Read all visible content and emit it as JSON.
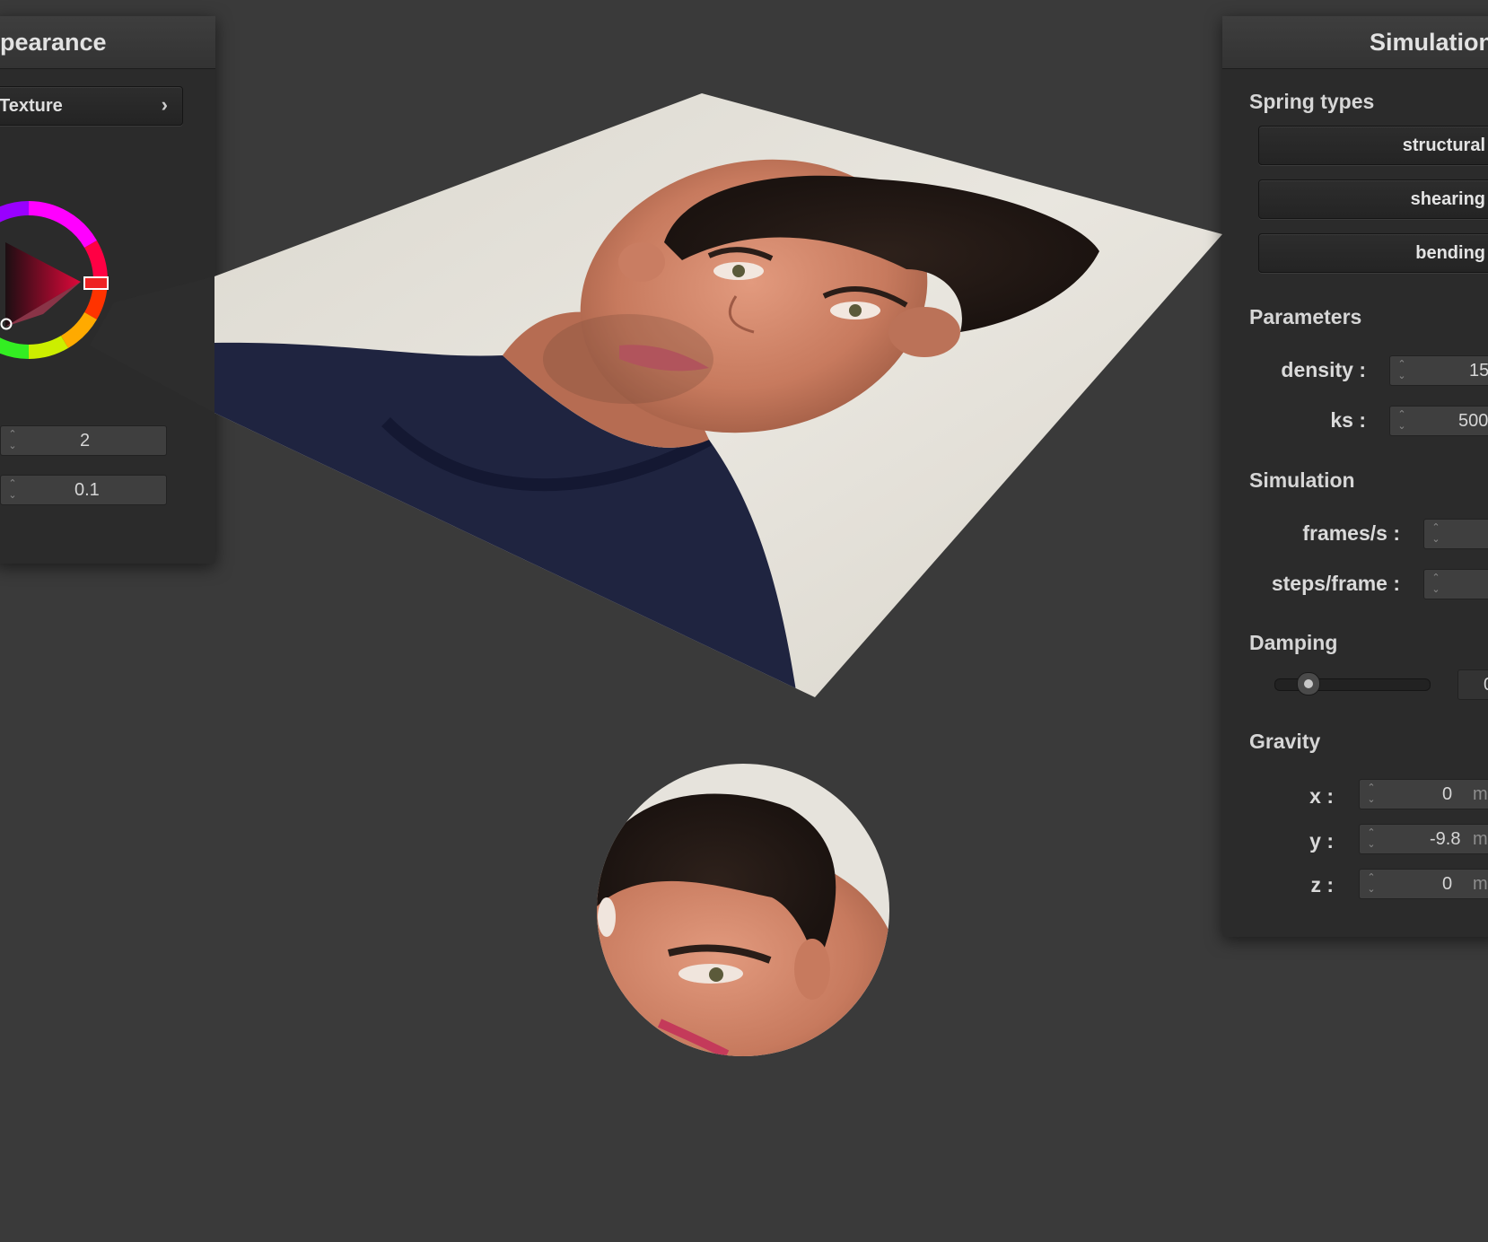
{
  "appearance_panel": {
    "title": "pearance",
    "texture_button": "Texture",
    "texture_chevron": "›",
    "spin1_value": "2",
    "spin2_value": "0.1"
  },
  "simulation_panel": {
    "title": "Simulation",
    "spring_types": {
      "label": "Spring types",
      "structural": "structural",
      "shearing": "shearing",
      "bending": "bending"
    },
    "parameters": {
      "label": "Parameters",
      "density_label": "density :",
      "density_value": "15",
      "ks_label": "ks :",
      "ks_value": "500"
    },
    "simulation": {
      "label": "Simulation",
      "fps_label": "frames/s :",
      "steps_label": "steps/frame :"
    },
    "damping": {
      "label": "Damping",
      "value_partial": "0",
      "slider_fraction": 0.2
    },
    "gravity": {
      "label": "Gravity",
      "x_label": "x :",
      "x_value": "0",
      "y_label": "y :",
      "y_value": "-9.8",
      "z_label": "z :",
      "z_value": "0",
      "unit_partial": "m"
    }
  },
  "icons": {
    "spin_arrows": "⌃⌄"
  }
}
